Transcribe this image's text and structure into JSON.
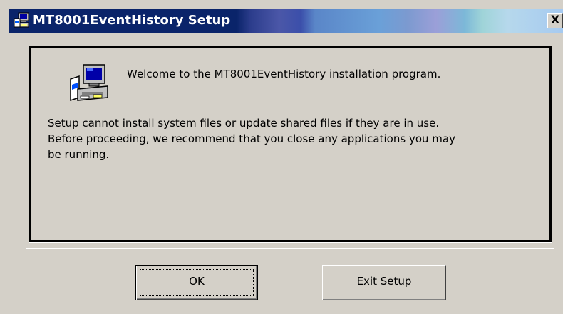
{
  "window": {
    "title": "MT8001EventHistory Setup",
    "close_label": "X"
  },
  "dialog": {
    "welcome": "Welcome to the MT8001EventHistory installation program.",
    "body_lines": [
      "Setup cannot install system files or update shared files if they are in use.",
      "Before proceeding, we recommend that you close any applications you may",
      "be running."
    ]
  },
  "buttons": {
    "ok_label": "OK",
    "exit_label_before": "E",
    "exit_label_mnemonic": "x",
    "exit_label_after": "it Setup"
  },
  "icons": {
    "title": "setup-computer-icon",
    "main": "setup-computer-icon"
  },
  "colors": {
    "titlebar_start": "#0a246a",
    "titlebar_end": "#a6caf0",
    "face": "#d4d0c8"
  }
}
